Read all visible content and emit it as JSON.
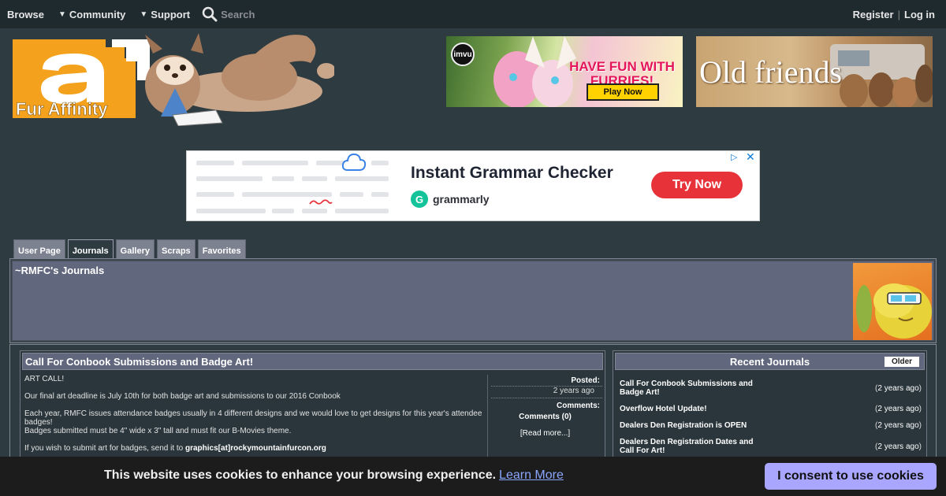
{
  "nav": {
    "browse": "Browse",
    "community": "Community",
    "support": "Support",
    "search_placeholder": "Search",
    "register": "Register",
    "separator": "|",
    "login": "Log in"
  },
  "logo": {
    "text": "Fur Affinity"
  },
  "banners": {
    "left": {
      "badge": "imvu",
      "headline": "HAVE FUN WITH FURRIES!",
      "cta": "Play Now"
    },
    "right": {
      "headline": "Old friends"
    }
  },
  "ad": {
    "headline": "Instant Grammar Checker",
    "brand": "grammarly",
    "cta": "Try Now"
  },
  "tabs": [
    "User Page",
    "Journals",
    "Gallery",
    "Scraps",
    "Favorites"
  ],
  "user_header": {
    "title": "~RMFC's Journals"
  },
  "journal": {
    "title": "Call For Conbook Submissions and Badge Art!",
    "lines": [
      "ART CALL!",
      "Our final art deadline is July 10th for both badge art and submissions to our 2016 Conbook",
      "Each year, RMFC issues attendance badges usually in 4 different designs and we would love to get designs for this year's attendee badges!",
      "Badges submitted must be 4\" wide x 3\" tall and must fit our B-Movies theme.",
      "If you wish to submit art for badges, send it to"
    ],
    "email": "graphics[at]rockymountainfurcon.org",
    "posted_label": "Posted:",
    "posted_value": "2 years ago",
    "comments_label": "Comments:",
    "comments_value": "Comments (0)",
    "read_more": "Read more..."
  },
  "recent": {
    "title": "Recent Journals",
    "older": "Older",
    "items": [
      {
        "title": "Call For Conbook Submissions and Badge Art!",
        "age": "2 years ago"
      },
      {
        "title": "Overflow Hotel Update!",
        "age": "2 years ago"
      },
      {
        "title": "Dealers Den Registration is OPEN",
        "age": "2 years ago"
      },
      {
        "title": "Dealers Den Registration Dates and Call For Art!",
        "age": "2 years ago"
      }
    ]
  },
  "cookie": {
    "message": "This website uses cookies to enhance your browsing experience.",
    "learn_more": "Learn More",
    "consent": "I consent to use cookies"
  },
  "colors": {
    "background": "#2e3b41",
    "panel": "#61677d",
    "cookie_button": "#a8a6ff",
    "ad_cta": "#e8323a",
    "grammarly": "#15c39a"
  }
}
